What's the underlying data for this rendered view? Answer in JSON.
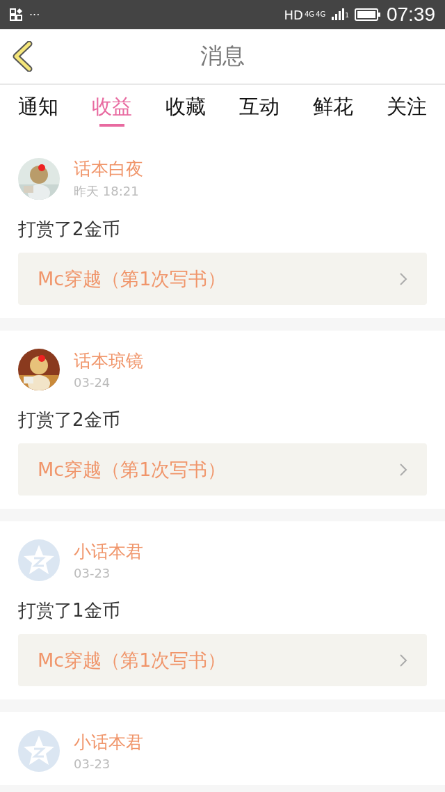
{
  "status_bar": {
    "more": "···",
    "hd": "HD",
    "network": [
      "4G",
      "4G"
    ],
    "sim": "1",
    "time": "07:39"
  },
  "header": {
    "title": "消息"
  },
  "tabs": [
    {
      "label": "通知",
      "selected": false
    },
    {
      "label": "收益",
      "selected": true
    },
    {
      "label": "收藏",
      "selected": false
    },
    {
      "label": "互动",
      "selected": false
    },
    {
      "label": "鲜花",
      "selected": false
    },
    {
      "label": "关注",
      "selected": false
    }
  ],
  "messages": [
    {
      "name": "话本白夜",
      "time": "昨天 18:21",
      "text": "打赏了2金币",
      "link": "Mc穿越（第1次写书）"
    },
    {
      "name": "话本琼镜",
      "time": "03-24",
      "text": "打赏了2金币",
      "link": "Mc穿越（第1次写书）"
    },
    {
      "avatar": {
        "kind": "default"
      },
      "name": "小话本君",
      "time": "03-23",
      "text": "打赏了1金币",
      "link": "Mc穿越（第1次写书）"
    },
    {
      "avatar": {
        "kind": "default"
      },
      "name": "小话本君",
      "time": "03-23"
    }
  ]
}
